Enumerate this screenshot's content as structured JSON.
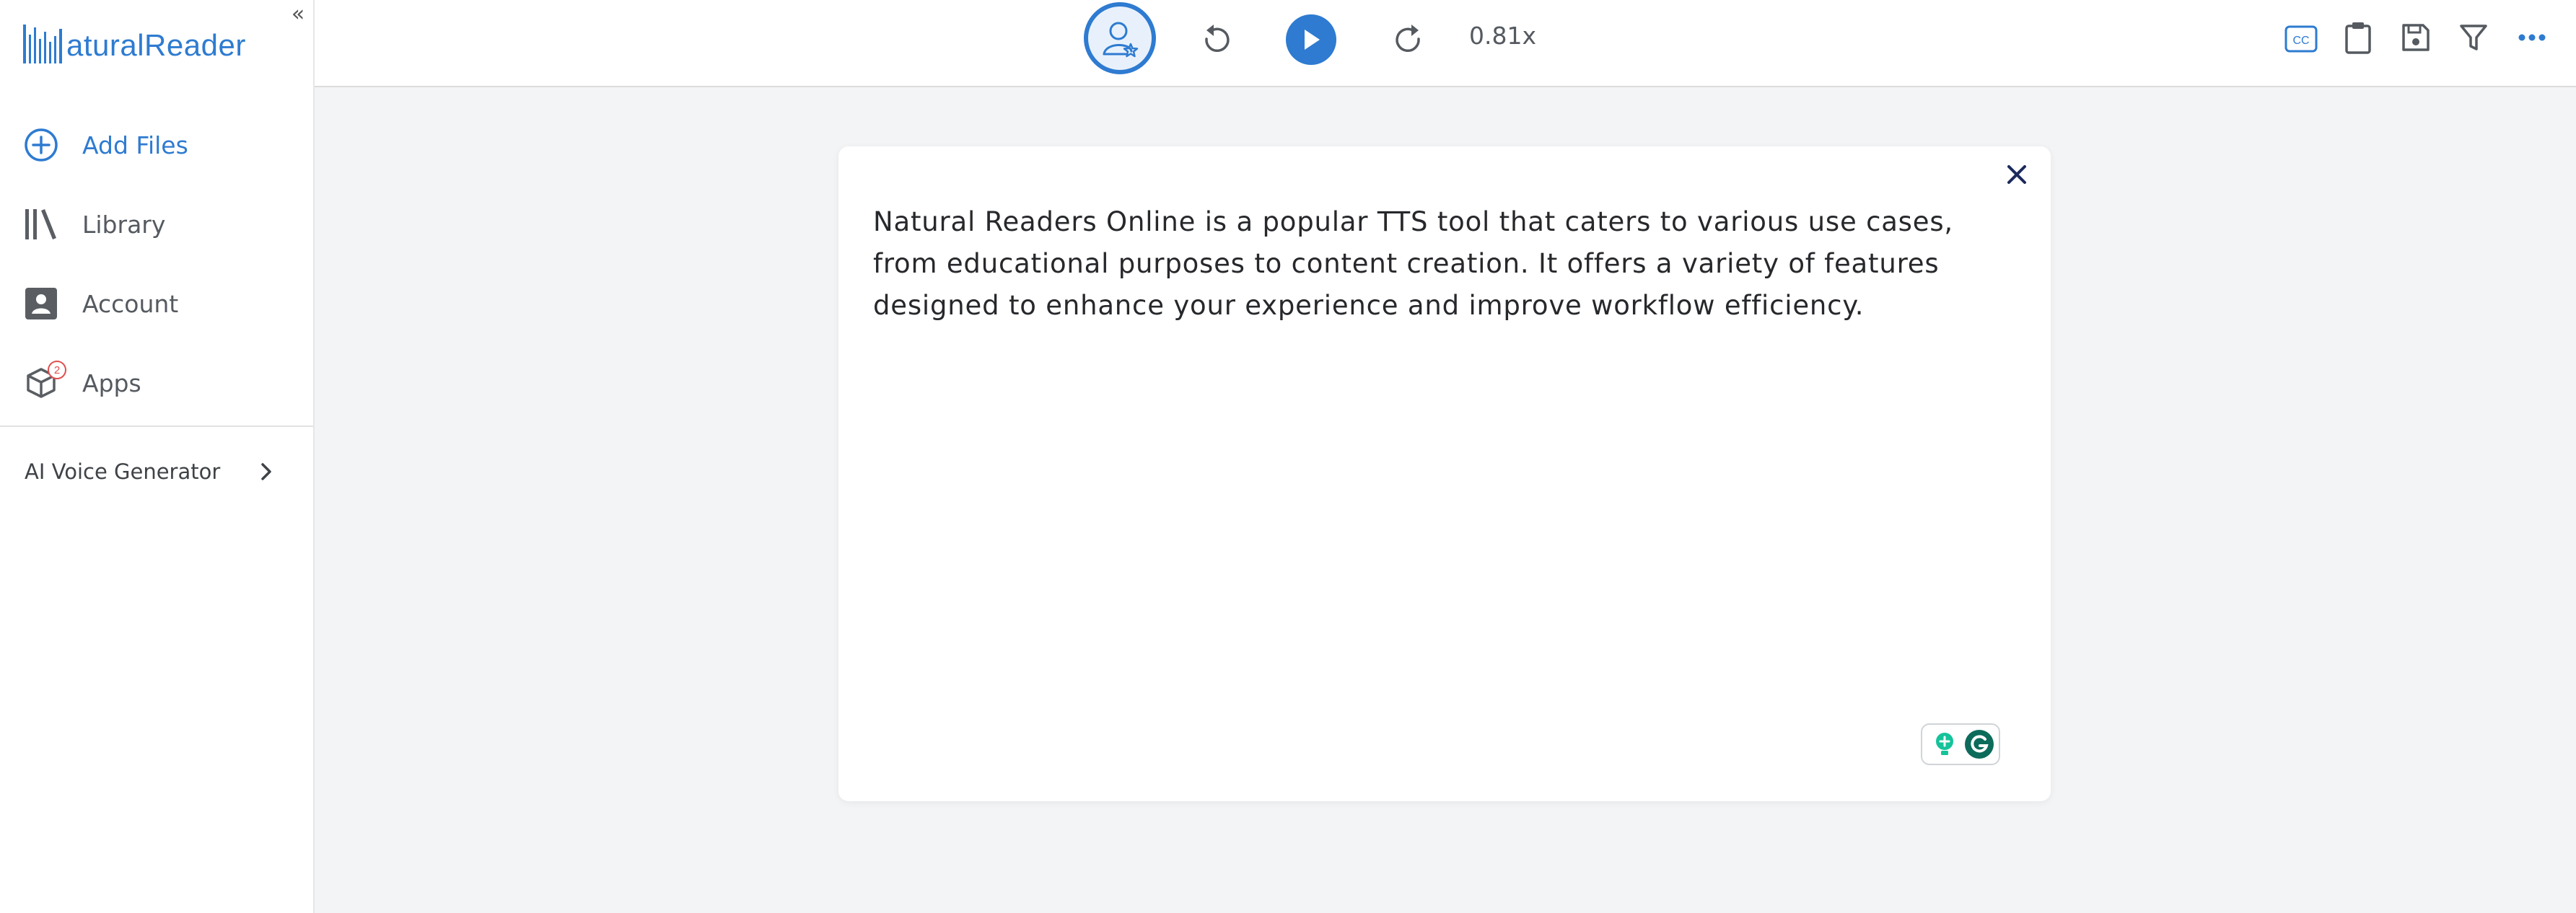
{
  "app": {
    "logo_text": "aturalReader",
    "collapse_glyph": "«"
  },
  "sidebar": {
    "items": [
      {
        "label": "Add Files",
        "icon": "plus-circle-icon"
      },
      {
        "label": "Library",
        "icon": "library-icon"
      },
      {
        "label": "Account",
        "icon": "account-icon"
      },
      {
        "label": "Apps",
        "icon": "apps-icon",
        "badge": "2"
      }
    ],
    "ai_voice_label": "AI Voice Generator"
  },
  "toolbar": {
    "speed": "0.81x",
    "cc_label": "CC"
  },
  "dialog": {
    "text": "Natural Readers Online is a popular TTS tool that caters to various use cases, from educational purposes to content creation. It offers a variety of features designed to enhance your experience and improve workflow efficiency."
  },
  "colors": {
    "accent": "#2e7bd1",
    "badge": "#e04f4f",
    "grammarly_green": "#15c39a",
    "grammarly_dark": "#0c6b5a"
  }
}
